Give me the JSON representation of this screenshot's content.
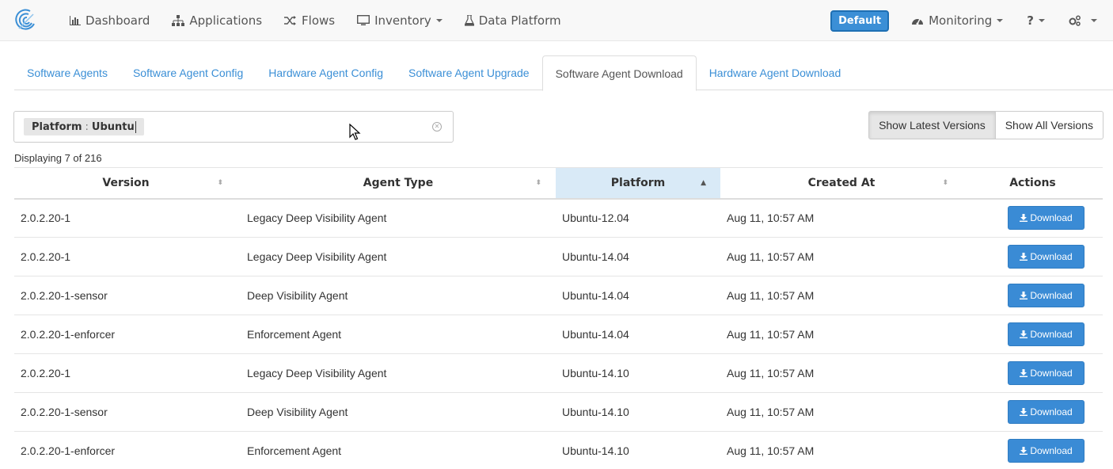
{
  "nav": {
    "left": [
      {
        "label": "Dashboard",
        "icon": "bar-chart-icon"
      },
      {
        "label": "Applications",
        "icon": "sitemap-icon"
      },
      {
        "label": "Flows",
        "icon": "shuffle-icon"
      },
      {
        "label": "Inventory",
        "icon": "monitor-icon",
        "dropdown": true
      },
      {
        "label": "Data Platform",
        "icon": "flask-icon"
      }
    ],
    "default_badge": "Default",
    "monitoring": "Monitoring",
    "help": "?",
    "settings_icon": "gears-icon"
  },
  "tabs": [
    {
      "label": "Software Agents",
      "active": false
    },
    {
      "label": "Software Agent Config",
      "active": false
    },
    {
      "label": "Hardware Agent Config",
      "active": false
    },
    {
      "label": "Software Agent Upgrade",
      "active": false
    },
    {
      "label": "Software Agent Download",
      "active": true
    },
    {
      "label": "Hardware Agent Download",
      "active": false
    }
  ],
  "filter": {
    "key": "Platform",
    "separator": ":",
    "value": "Ubuntu"
  },
  "toggle": {
    "latest": "Show Latest Versions",
    "all": "Show All Versions"
  },
  "display_count": "Displaying 7 of 216",
  "table": {
    "headers": {
      "version": "Version",
      "agent_type": "Agent Type",
      "platform": "Platform",
      "created_at": "Created At",
      "actions": "Actions"
    },
    "sorted_column": "platform",
    "download_label": "Download",
    "rows": [
      {
        "version": "2.0.2.20-1",
        "agent_type": "Legacy Deep Visibility Agent",
        "platform": "Ubuntu-12.04",
        "created_at": "Aug 11, 10:57 AM"
      },
      {
        "version": "2.0.2.20-1",
        "agent_type": "Legacy Deep Visibility Agent",
        "platform": "Ubuntu-14.04",
        "created_at": "Aug 11, 10:57 AM"
      },
      {
        "version": "2.0.2.20-1-sensor",
        "agent_type": "Deep Visibility Agent",
        "platform": "Ubuntu-14.04",
        "created_at": "Aug 11, 10:57 AM"
      },
      {
        "version": "2.0.2.20-1-enforcer",
        "agent_type": "Enforcement Agent",
        "platform": "Ubuntu-14.04",
        "created_at": "Aug 11, 10:57 AM"
      },
      {
        "version": "2.0.2.20-1",
        "agent_type": "Legacy Deep Visibility Agent",
        "platform": "Ubuntu-14.10",
        "created_at": "Aug 11, 10:57 AM"
      },
      {
        "version": "2.0.2.20-1-sensor",
        "agent_type": "Deep Visibility Agent",
        "platform": "Ubuntu-14.10",
        "created_at": "Aug 11, 10:57 AM"
      },
      {
        "version": "2.0.2.20-1-enforcer",
        "agent_type": "Enforcement Agent",
        "platform": "Ubuntu-14.10",
        "created_at": "Aug 11, 10:57 AM"
      }
    ]
  },
  "colors": {
    "accent": "#3b8fd6",
    "sorted_header": "#d9eaf7"
  }
}
